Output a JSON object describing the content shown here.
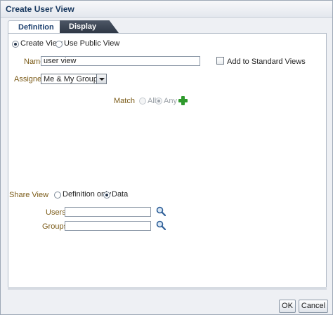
{
  "dialog": {
    "title": "Create User View"
  },
  "tabs": [
    {
      "label": "Definition",
      "selected": true
    },
    {
      "label": "Display",
      "selected": false
    }
  ],
  "view_source": {
    "options": [
      {
        "label": "Create View",
        "selected": true
      },
      {
        "label": "Use Public View",
        "selected": false
      }
    ]
  },
  "name": {
    "label": "Name",
    "value": "user view"
  },
  "add_to_standard": {
    "label": "Add to Standard Views",
    "checked": false
  },
  "assignee": {
    "label": "Assignee",
    "value": "Me & My Group"
  },
  "match": {
    "label": "Match",
    "options": [
      {
        "label": "All",
        "selected": false
      },
      {
        "label": "Any",
        "selected": true
      }
    ],
    "add_icon": "add-icon"
  },
  "share_view": {
    "label": "Share View",
    "options": [
      {
        "label": "Definition only",
        "selected": false
      },
      {
        "label": "Data",
        "selected": true
      }
    ]
  },
  "users": {
    "label": "Users",
    "value": "",
    "icon": "search-icon"
  },
  "groups": {
    "label": "Groups",
    "value": "",
    "icon": "search-icon"
  },
  "footer": {
    "ok_label": "OK",
    "cancel_label": "Cancel"
  },
  "colors": {
    "title": "#17375e",
    "label_gold": "#7a5a16",
    "tab_active_bg": "#ffffff",
    "tab_inactive_bg": "#3a4452",
    "add_icon": "#2f9a2d"
  }
}
